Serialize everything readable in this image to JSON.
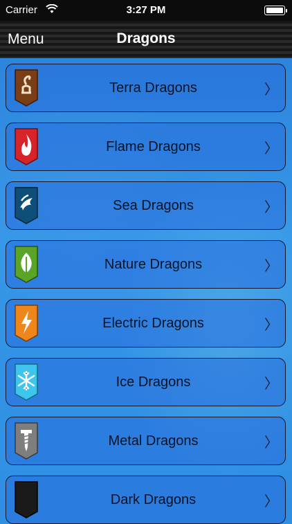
{
  "status_bar": {
    "carrier": "Carrier",
    "time": "3:27 PM"
  },
  "nav": {
    "menu_label": "Menu",
    "title": "Dragons"
  },
  "rows": [
    {
      "label": "Terra Dragons",
      "icon": "terra-icon",
      "color": "#8a4a1c"
    },
    {
      "label": "Flame Dragons",
      "icon": "flame-icon",
      "color": "#d9262a"
    },
    {
      "label": "Sea Dragons",
      "icon": "sea-icon",
      "color": "#0d4f7a"
    },
    {
      "label": "Nature Dragons",
      "icon": "leaf-icon",
      "color": "#5aa428"
    },
    {
      "label": "Electric Dragons",
      "icon": "lightning-icon",
      "color": "#f08a1c"
    },
    {
      "label": "Ice Dragons",
      "icon": "snowflake-icon",
      "color": "#3ec7ee"
    },
    {
      "label": "Metal Dragons",
      "icon": "screw-icon",
      "color": "#8a8a8a"
    },
    {
      "label": "Dark Dragons",
      "icon": "moon-icon",
      "color": "#1a1a1a"
    }
  ],
  "chevron": "〉"
}
